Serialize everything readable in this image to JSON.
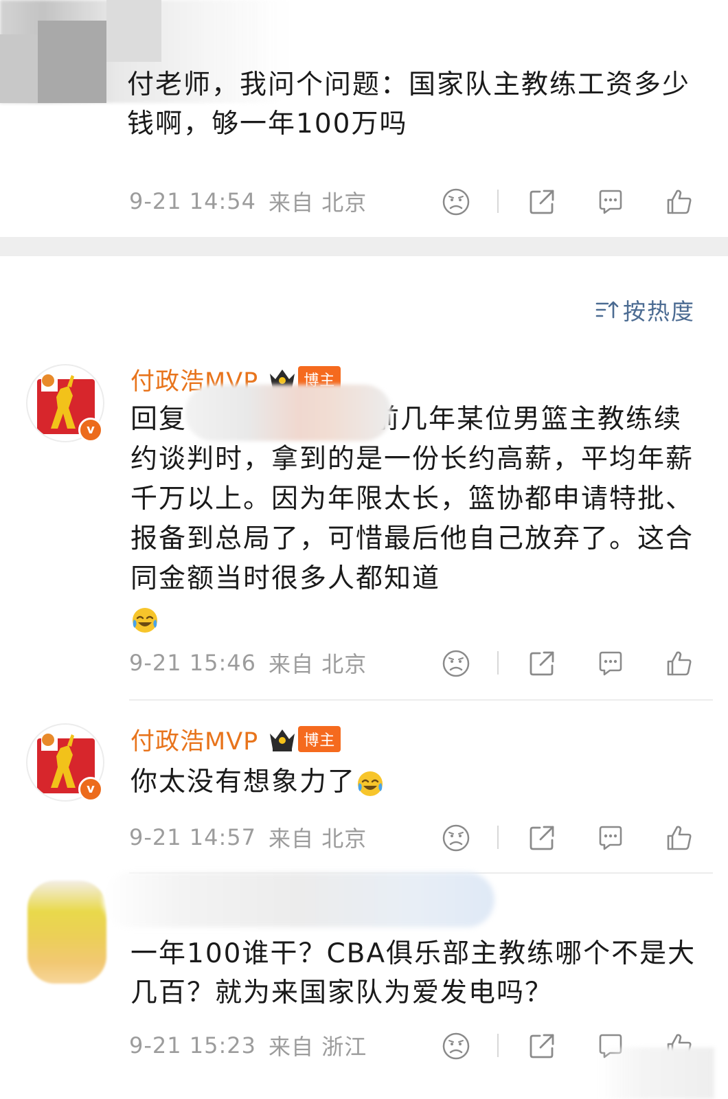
{
  "top_post": {
    "text": "付老师，我问个问题：国家队主教练工资多少钱啊，够一年100万吗",
    "time": "9-21 14:54",
    "location": "来自 北京"
  },
  "sort": {
    "label": "按热度"
  },
  "comments": [
    {
      "username": "付政浩MVP",
      "badge": "博主",
      "text_prefix": "回复",
      "text": "前几年某位男篮主教练续约谈判时，拿到的是一份长约高薪，平均年薪千万以上。因为年限太长，篮协都申请特批、报备到总局了，可惜最后他自己放弃了。这合同金额当时很多人都知道",
      "time": "9-21 15:46",
      "location": "来自 北京"
    },
    {
      "username": "付政浩MVP",
      "badge": "博主",
      "text": "你太没有想象力了",
      "time": "9-21 14:57",
      "location": "来自 北京"
    },
    {
      "text": "一年100谁干？CBA俱乐部主教练哪个不是大几百？就为来国家队为爱发电吗？",
      "time": "9-21 15:23",
      "location": "来自 浙江"
    }
  ],
  "icons": {
    "dislike": "dislike-face-icon",
    "share": "share-icon",
    "comment": "comment-icon",
    "like": "thumbs-up-icon",
    "sort": "sort-icon",
    "crown": "crown-icon",
    "emoji": "laugh-cry-emoji"
  },
  "colors": {
    "username": "#e8741c",
    "badge": "#f56a1e",
    "meta": "#9c9c9c",
    "sort": "#4b6b92",
    "gap": "#eeeeee"
  }
}
